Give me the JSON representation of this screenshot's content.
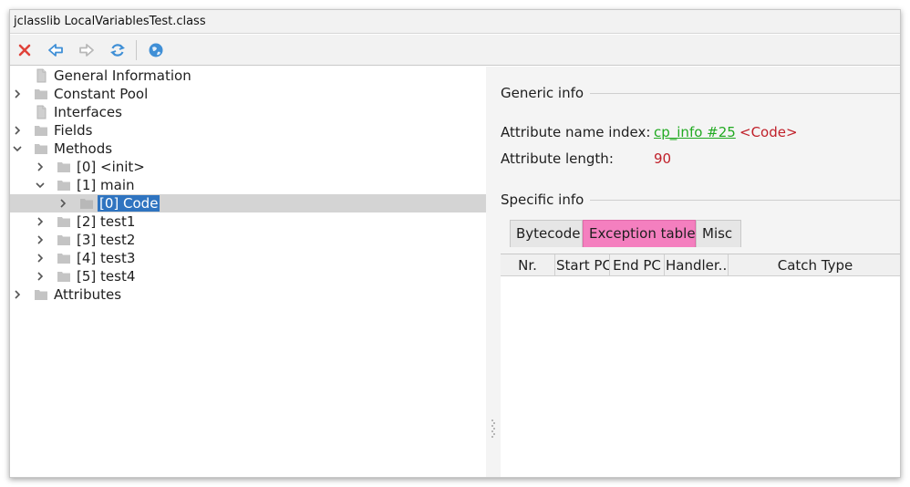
{
  "window": {
    "title": "jclasslib LocalVariablesTest.class"
  },
  "toolbar": {
    "buttons": [
      {
        "name": "close-icon",
        "color": "#e0423a"
      },
      {
        "name": "back-arrow-icon",
        "color": "#3f8fd6"
      },
      {
        "name": "forward-arrow-icon",
        "color": "#b8b8b8"
      },
      {
        "name": "refresh-icon",
        "color": "#3f8fd6"
      },
      {
        "name": "web-globe-icon",
        "color": "#3f8fd6"
      }
    ]
  },
  "tree": {
    "items": [
      {
        "label": "General Information",
        "icon": "file-icon",
        "expander": "none"
      },
      {
        "label": "Constant Pool",
        "icon": "folder-icon",
        "expander": "collapsed"
      },
      {
        "label": "Interfaces",
        "icon": "file-icon",
        "expander": "none"
      },
      {
        "label": "Fields",
        "icon": "folder-icon",
        "expander": "collapsed"
      },
      {
        "label": "Methods",
        "icon": "folder-icon",
        "expander": "expanded"
      },
      {
        "label": "[0] <init>",
        "icon": "folder-icon",
        "expander": "collapsed"
      },
      {
        "label": "[1] main",
        "icon": "folder-icon",
        "expander": "expanded"
      },
      {
        "label": "[0] Code",
        "icon": "folder-icon",
        "expander": "collapsed",
        "selected": true
      },
      {
        "label": "[2] test1",
        "icon": "folder-icon",
        "expander": "collapsed"
      },
      {
        "label": "[3] test2",
        "icon": "folder-icon",
        "expander": "collapsed"
      },
      {
        "label": "[4] test3",
        "icon": "folder-icon",
        "expander": "collapsed"
      },
      {
        "label": "[5] test4",
        "icon": "folder-icon",
        "expander": "collapsed"
      },
      {
        "label": "Attributes",
        "icon": "folder-icon",
        "expander": "collapsed"
      }
    ]
  },
  "details": {
    "generic_title": "Generic info",
    "name_index_label": "Attribute name index:",
    "name_index_link": "cp_info #25",
    "name_index_value": "<Code>",
    "length_label": "Attribute length:",
    "length_value": "90",
    "specific_title": "Specific info",
    "tabs": [
      {
        "label": "Bytecode",
        "active": false
      },
      {
        "label": "Exception table",
        "active": true
      },
      {
        "label": "Misc",
        "active": false
      }
    ],
    "columns": [
      "Nr.",
      "Start PC",
      "End PC",
      "Handler...",
      "Catch Type"
    ]
  },
  "colors": {
    "selection": "#2f74c0",
    "active_tab": "#f47fbf",
    "link": "#22aa22",
    "value": "#c0202a"
  }
}
